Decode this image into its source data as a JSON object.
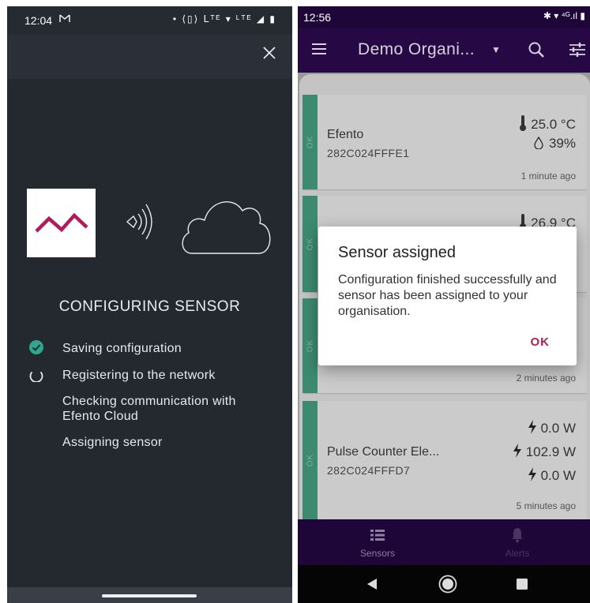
{
  "left": {
    "status": {
      "time": "12:04",
      "mail_icon": "gmail-icon",
      "icons_text": "• ⟨▯⟩ ᒪᵀᴱ ▾ ᴸᵀᴱ ◢ ▮"
    },
    "close_label": "✕",
    "heading": "CONFIGURING SENSOR",
    "steps": [
      {
        "label": "Saving configuration",
        "state": "done"
      },
      {
        "label": "Registering to the network",
        "state": "in-progress"
      },
      {
        "label": "Checking communication with Efento Cloud",
        "state": "pending"
      },
      {
        "label": "Assigning sensor",
        "state": "pending"
      }
    ],
    "colors": {
      "background": "#24282f",
      "check": "#2fa78f",
      "logo": "#b21b5a"
    }
  },
  "right": {
    "status": {
      "time": "12:56",
      "icons_text": "✱ ▾ ⁴ᴳ.ıl ▮"
    },
    "appbar": {
      "org_name": "Demo Organi...",
      "menu_icon": "hamburger-menu-icon",
      "search_icon": "search-icon",
      "filter_icon": "tune-icon"
    },
    "cards": [
      {
        "status": "OK",
        "name": "Efento",
        "id": "282C024FFFE1",
        "readings": [
          "25.0 °C",
          "39%"
        ],
        "reading_icons": [
          "thermometer-icon",
          "humidity-icon"
        ],
        "ago": "1 minute ago"
      },
      {
        "status": "OK",
        "name": "",
        "id": "",
        "readings": [
          "26.9 °C"
        ],
        "reading_icons": [
          "thermometer-icon"
        ],
        "ago": ""
      },
      {
        "status": "OK",
        "name": "",
        "id": "",
        "readings": [],
        "reading_icons": [],
        "ago": "2 minutes ago"
      },
      {
        "status": "OK",
        "name": "Pulse Counter Ele...",
        "id": "282C024FFFD7",
        "readings": [
          "0.0 W",
          "102.9 W",
          "0.0 W"
        ],
        "reading_icons": [
          "bolt-icon",
          "bolt-icon",
          "bolt-icon"
        ],
        "ago": "5 minutes ago"
      }
    ],
    "dialog": {
      "title": "Sensor assigned",
      "message": "Configuration finished successfully and sensor has been assigned to your organisation.",
      "ok_label": "OK"
    },
    "bottom_nav": [
      {
        "label": "Sensors",
        "icon": "list-icon",
        "active": true
      },
      {
        "label": "Alerts",
        "icon": "bell-icon",
        "active": false
      }
    ],
    "colors": {
      "appbar": "#260844",
      "ok_strip": "#3d8a70",
      "accent": "#b21b5a"
    }
  }
}
